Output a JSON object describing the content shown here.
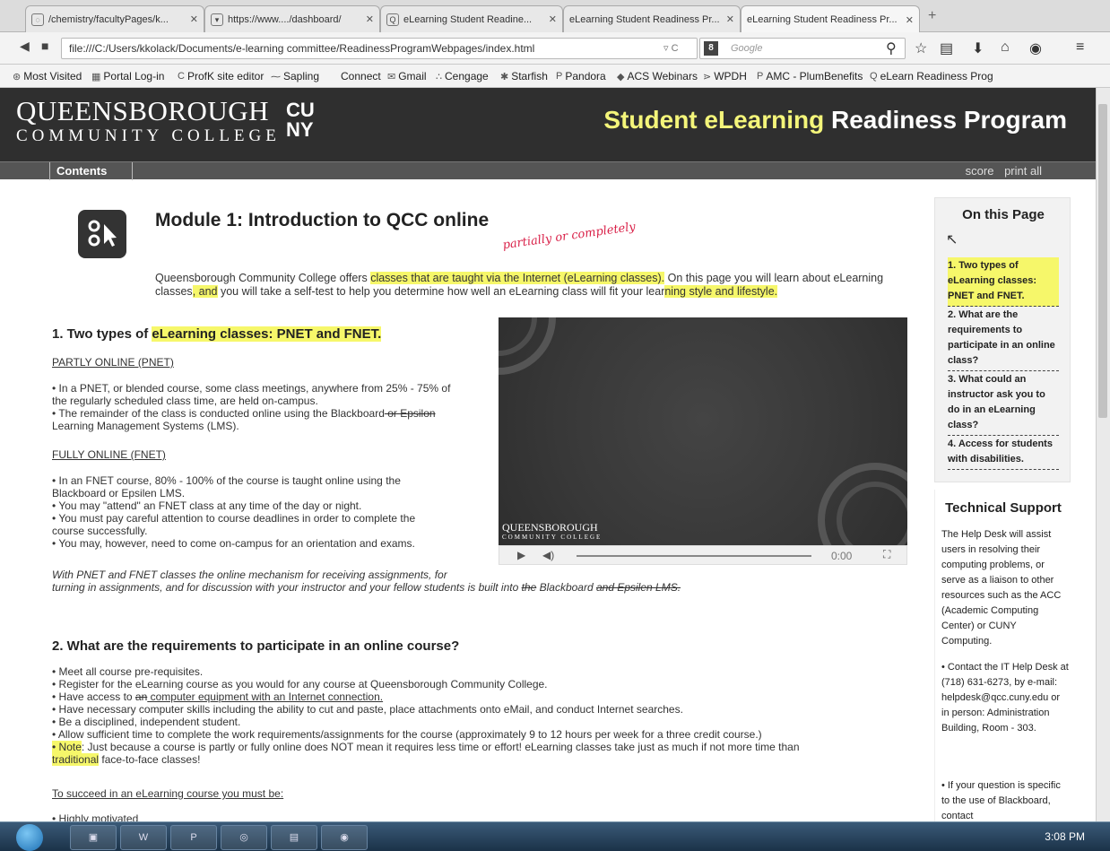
{
  "browser": {
    "tabs": [
      {
        "title": "/chemistry/facultyPages/k...",
        "icon": "page-icon"
      },
      {
        "title": "https://www..../dashboard/",
        "icon": "bookmark-icon"
      },
      {
        "title": "eLearning Student Readine...",
        "icon": "search-icon"
      },
      {
        "title": "eLearning Student Readiness Pr...",
        "icon": "none"
      },
      {
        "title": "eLearning Student Readiness Pr...",
        "icon": "none"
      }
    ],
    "new_tab": "+",
    "url": "file:///C:/Users/kkolack/Documents/e-learning committee/ReadinessProgramWebpages/index.html",
    "search_placeholder": "Google",
    "search_engine": "8",
    "bookmarks": [
      "Most Visited",
      "Portal Log-in",
      "ProfK site editor",
      "Sapling",
      "Connect",
      "Gmail",
      "Cengage",
      "Starfish",
      "Pandora",
      "ACS Webinars",
      "WPDH",
      "AMC - PlumBenefits",
      "eLearn Readiness Prog"
    ]
  },
  "banner": {
    "logo_main": "QUEENSBOROUGH",
    "logo_sub": "COMMUNITY COLLEGE",
    "cuny_top": "CU",
    "cuny_bottom": "NY",
    "title_part1": "Student eLearning",
    "title_part2": "Readiness Program"
  },
  "subnav": {
    "contents": "Contents",
    "score": "score",
    "print_all": "print all"
  },
  "module": {
    "title": "Module 1: Introduction to QCC online",
    "handwritten_note": "partially or completely",
    "intro_pre": "Queensborough Community College offers ",
    "intro_hl1": "classes that are taught via the Internet (eLearning classes).",
    "intro_mid": " On this page you will learn about eLearning classes",
    "intro_hl2": ", and",
    "intro_post": " you will take a self-test to help you determine how well an eLearning class will fit your lear",
    "intro_hl3": "ning style and lifestyle."
  },
  "section1": {
    "heading_pre": "1. Two types of ",
    "heading_hl": "eLearning classes: PNET and FNET.",
    "partly_label": "PARTLY ONLINE (PNET)",
    "pnet_lines": [
      "• In a PNET, or blended course, some class meetings, anywhere from 25% - 75% of",
      "the regularly scheduled class time, are held on-campus.",
      "• The remainder of the class is conducted online using the Blackboard"
    ],
    "pnet_strike": " or Epsilon",
    "pnet_last": "Learning Management Systems (LMS).",
    "fully_label": "FULLY ONLINE (FNET)",
    "fnet_lines": [
      "• In an FNET course, 80% - 100% of the course is taught online using the",
      "Blackboard or Epsilen LMS.",
      "• You may \"attend\" an FNET class at any time of the day or night.",
      "• You must pay careful attention to course deadlines in order to complete the",
      "course successfully.",
      "• You may, however, need to come on-campus for an orientation and exams."
    ],
    "note_line1": "With PNET and FNET classes the online mechanism for receiving assignments, for",
    "note_line2_pre": "turning in assignments, and for discussion with your instructor and your fellow students is built into ",
    "note_line2_strike1": "the",
    "note_line2_mid": " Blackboard ",
    "note_line2_strike2": "and Epsilen LMS."
  },
  "video": {
    "logo_main": "QUEENSBOROUGH",
    "logo_sub": "COMMUNITY COLLEGE",
    "time": "0:00"
  },
  "section2": {
    "heading": "2. What are the requirements to participate in an online course?",
    "items": [
      "• Meet all course pre-requisites.",
      "• Register for the eLearning course as you would for any course at Queensborough Community College.",
      "• Have necessary computer skills including the ability to cut and paste, place attachments onto eMail, and conduct Internet searches.",
      "• Be a disciplined, independent student.",
      "• Allow sufficient time to complete the work requirements/assignments for the course (approximately 9 to 12 hours per week for a three credit course.)"
    ],
    "access_pre": "• Have access to ",
    "access_strike": "an",
    "access_link": " computer equipment with an Internet connection.",
    "note_hl": "• Note",
    "note_text": ": Just because a course is partly or fully online does NOT mean it requires less time or effort! eLearning classes take just as much if not more time than",
    "note_hl2": "traditional",
    "note_end": " face-to-face classes!",
    "succeed": "To succeed in an eLearning course you must be:",
    "first_trait": "• Highly motivated"
  },
  "sidebar": {
    "on_this_page": "On this Page",
    "links": [
      "1. Two types of eLearning classes: PNET and FNET.",
      "2. What are the requirements to participate in an online class?",
      "3. What could an instructor ask you to do in an eLearning class?",
      "4. Access for students with disabilities."
    ],
    "tech_title": "Technical Support",
    "tech_p1": "The Help Desk will assist users in resolving their computing problems, or serve as a liaison to other resources such as the ACC (Academic Computing Center) or CUNY Computing.",
    "tech_p2": "• Contact the IT Help Desk at (718) 631-6273, by e-mail: helpdesk@qcc.cuny.edu or in person: Administration Building, Room - 303.",
    "tech_p3": "• If your question is specific to the use of Blackboard, contact"
  },
  "taskbar": {
    "clock": "3:08 PM"
  },
  "colors": {
    "highlighter": "#f6f76a",
    "banner_bg": "#2f2f2f",
    "ink_red": "#d92048"
  }
}
